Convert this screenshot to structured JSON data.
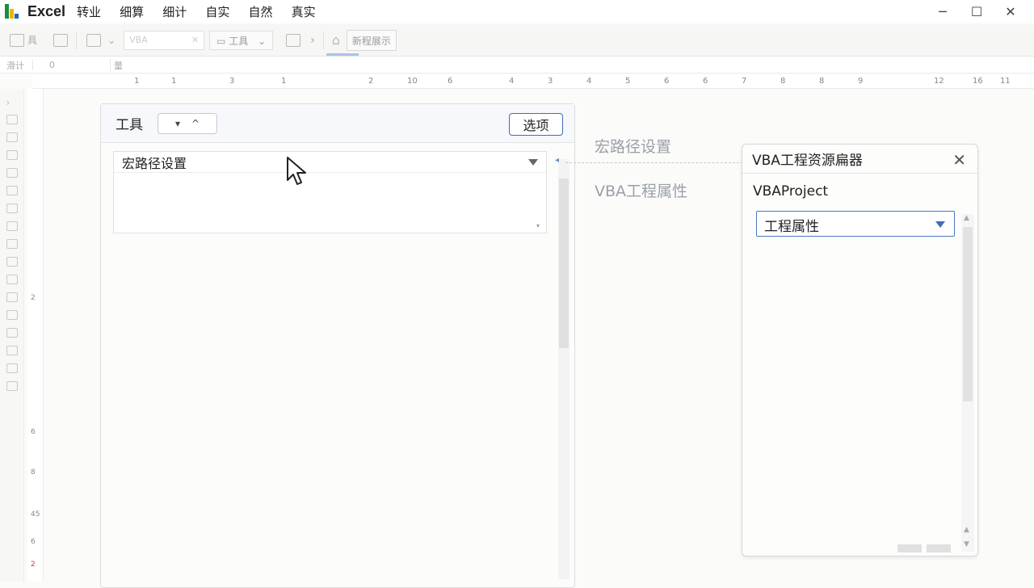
{
  "app": {
    "name": "Excel"
  },
  "menu": [
    "转业",
    "细算",
    "细计",
    "自实",
    "自然",
    "真实"
  ],
  "window_controls": {
    "minimize": "─",
    "maximize": "☐",
    "close": "✕"
  },
  "toolbar": {
    "item1_label": "具",
    "search_placeholder": "VBA",
    "dropdown_label": "工具",
    "button_label": "新程展示"
  },
  "formula_bar": {
    "name_box": "滑计",
    "value": "0",
    "fx": "量"
  },
  "ruler_labels": [
    "1",
    "1",
    "3",
    "1",
    "2",
    "10",
    "6",
    "4",
    "3",
    "4",
    "5",
    "6",
    "6",
    "7",
    "8",
    "8",
    "9",
    "12",
    "16",
    "11"
  ],
  "vruler_labels": [
    "2",
    "6",
    "8",
    "6",
    "45",
    "2"
  ],
  "tool_panel": {
    "title": "工具",
    "sort_down": "▾",
    "sort_up": "^",
    "options_button": "选项",
    "path_select": "宏路径设置"
  },
  "floating_labels": {
    "macro_path": "宏路径设置",
    "vba_props": "VBA工程属性"
  },
  "vba_panel": {
    "title": "VBA工程资源扁器",
    "close": "✕",
    "project": "VBAProject",
    "select_value": "工程属性"
  }
}
